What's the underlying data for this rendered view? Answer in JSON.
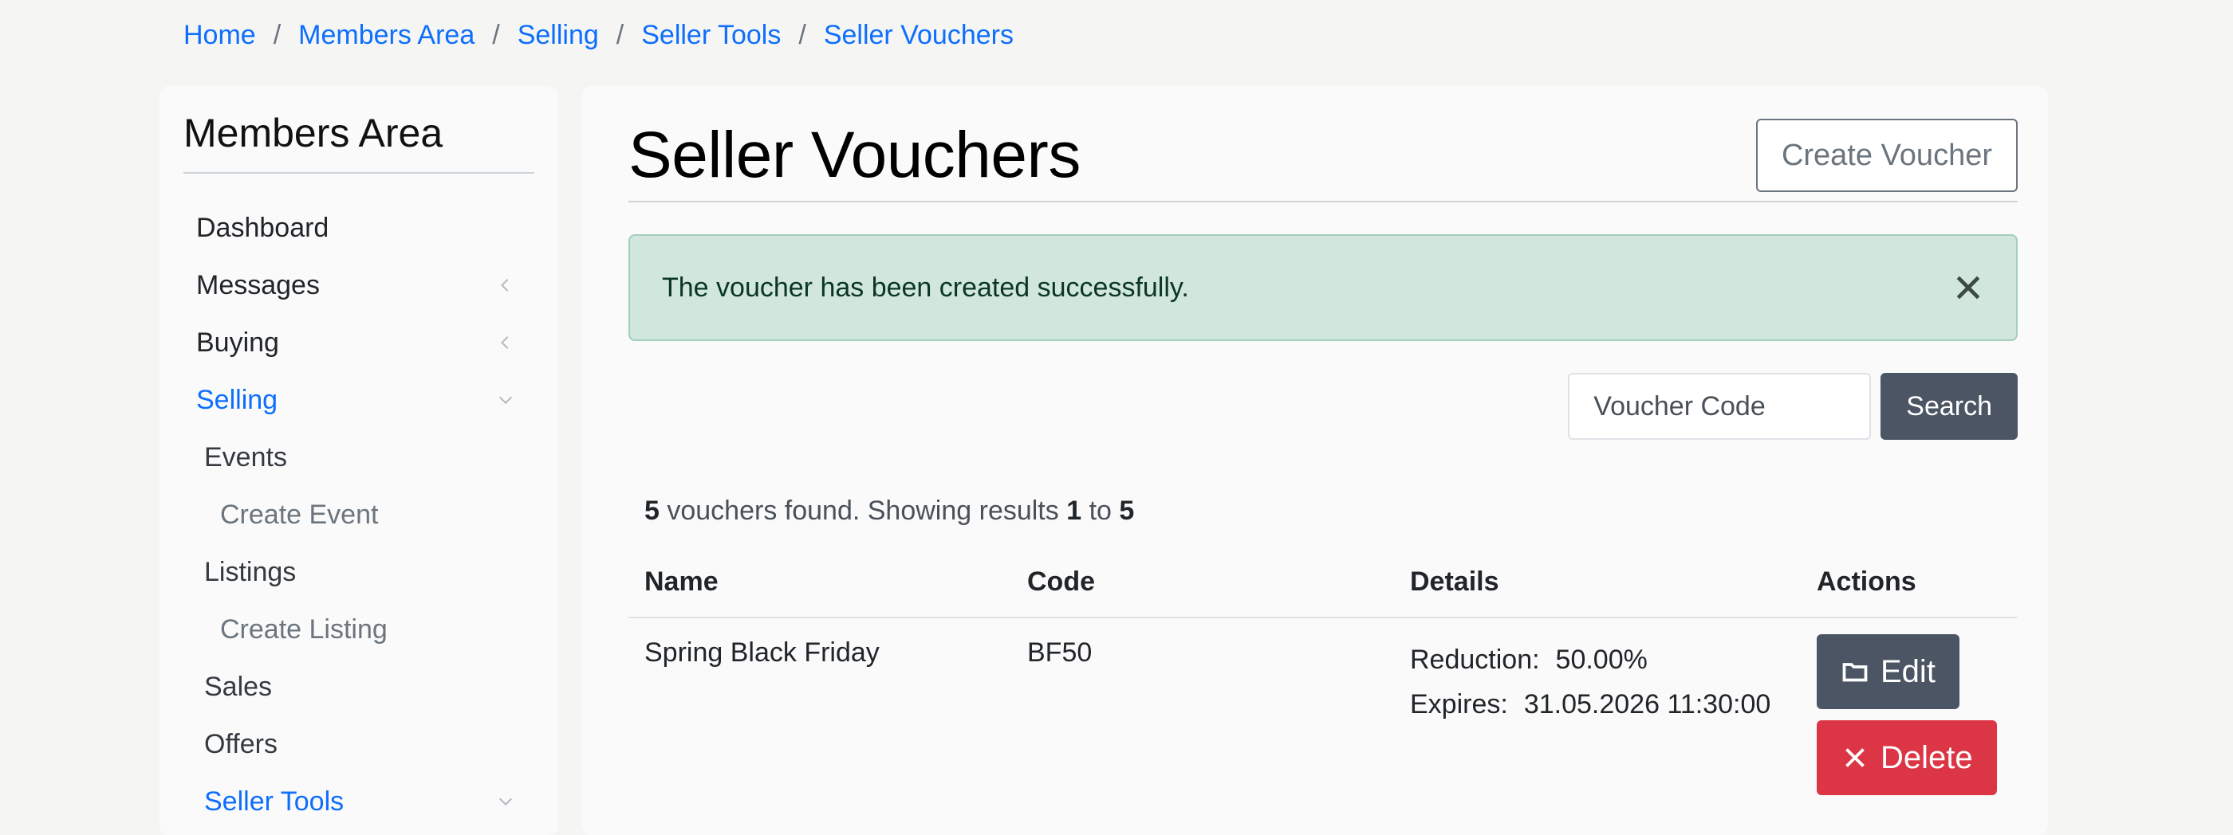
{
  "breadcrumb": [
    "Home",
    "Members Area",
    "Selling",
    "Seller Tools",
    "Seller Vouchers"
  ],
  "sidebar": {
    "title": "Members Area",
    "items": [
      {
        "label": "Dashboard"
      },
      {
        "label": "Messages",
        "icon": "chevron-left-icon"
      },
      {
        "label": "Buying",
        "icon": "chevron-left-icon"
      },
      {
        "label": "Selling",
        "icon": "chevron-down-icon",
        "active": true
      },
      {
        "label": "Events"
      },
      {
        "label": "Create Event"
      },
      {
        "label": "Listings"
      },
      {
        "label": "Create Listing"
      },
      {
        "label": "Sales"
      },
      {
        "label": "Offers"
      },
      {
        "label": "Seller Tools",
        "icon": "chevron-down-icon",
        "active": true
      }
    ]
  },
  "main": {
    "title": "Seller Vouchers",
    "create_button": "Create Voucher",
    "alert": {
      "message": "The voucher has been created successfully.",
      "icon": "close-icon"
    },
    "search": {
      "placeholder": "Voucher Code",
      "button": "Search"
    },
    "results": {
      "count": "5",
      "text_mid": " vouchers found. Showing results ",
      "from": "1",
      "to_word": " to ",
      "to": "5"
    },
    "table": {
      "headers": [
        "Name",
        "Code",
        "Details",
        "Actions"
      ],
      "rows": [
        {
          "name": "Spring Black Friday",
          "code": "BF50",
          "reduction_label": "Reduction:",
          "reduction": "50.00%",
          "expires_label": "Expires:",
          "expires": "31.05.2026 11:30:00",
          "edit_label": "Edit",
          "edit_icon": "folder-icon",
          "delete_label": "Delete",
          "delete_icon": "x-icon"
        }
      ]
    }
  },
  "colors": {
    "link": "#0d6efd",
    "alert_bg": "#d1e7dd",
    "dark_button": "#4b5563",
    "danger": "#dc3545"
  }
}
